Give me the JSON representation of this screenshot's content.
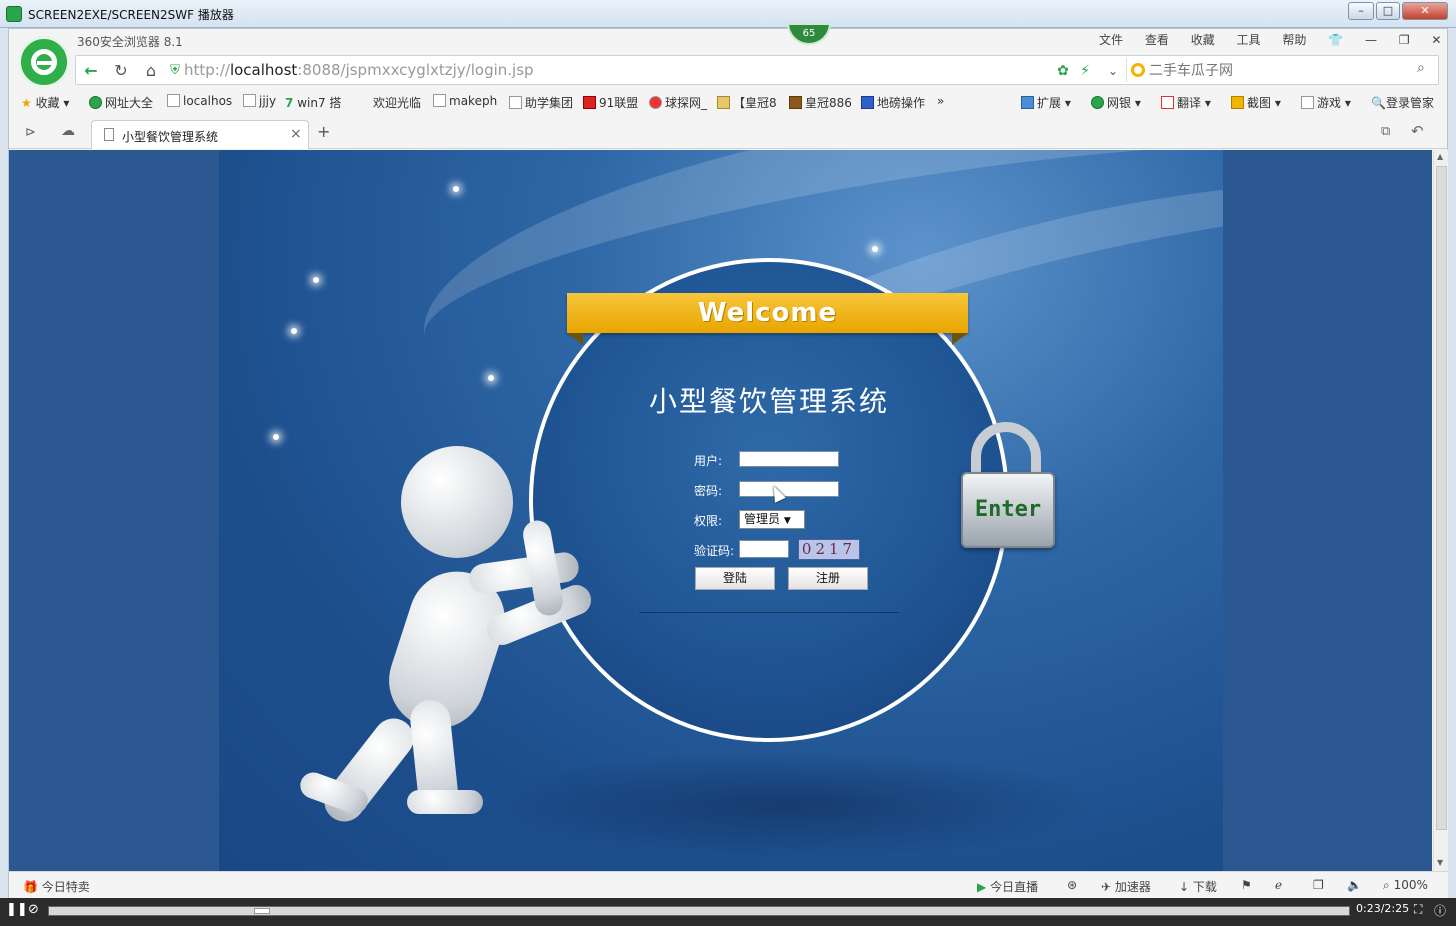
{
  "outer_window": {
    "title": "SCREEN2EXE/SCREEN2SWF 播放器"
  },
  "browser": {
    "name": "360安全浏览器 8.1",
    "badge": "65",
    "menu": [
      "文件",
      "查看",
      "收藏",
      "工具",
      "帮助"
    ],
    "url_scheme": "http://",
    "url_host": "localhost",
    "url_rest": ":8088/jspmxxcyglxtzjy/login.jsp",
    "search_placeholder": "二手车瓜子网",
    "bookmarks": [
      "收藏",
      "网址大全",
      "localhos",
      "jjjy",
      "win7 搭",
      "欢迎光临",
      "makeph",
      "助学集团",
      "91联盟",
      "球探网_",
      "【皇冠8",
      "皇冠886",
      "地磅操作"
    ],
    "bookmarks_right": [
      "扩展",
      "网银",
      "翻译",
      "截图",
      "游戏",
      "登录管家"
    ],
    "tab_title": "小型餐饮管理系统"
  },
  "login": {
    "banner": "Welcome",
    "system_title": "小型餐饮管理系统",
    "user_label": "用户:",
    "password_label": "密码:",
    "role_label": "权限:",
    "role_value": "管理员",
    "captcha_label": "验证码:",
    "captcha_value": "0217",
    "login_button": "登陆",
    "register_button": "注册",
    "enter_label": "Enter"
  },
  "statusbar": {
    "left": "今日特卖",
    "live": "今日直播",
    "accelerator": "加速器",
    "download": "下载",
    "zoom": "100%"
  },
  "player": {
    "time": "0:23/2:25",
    "progress": 0.16
  }
}
